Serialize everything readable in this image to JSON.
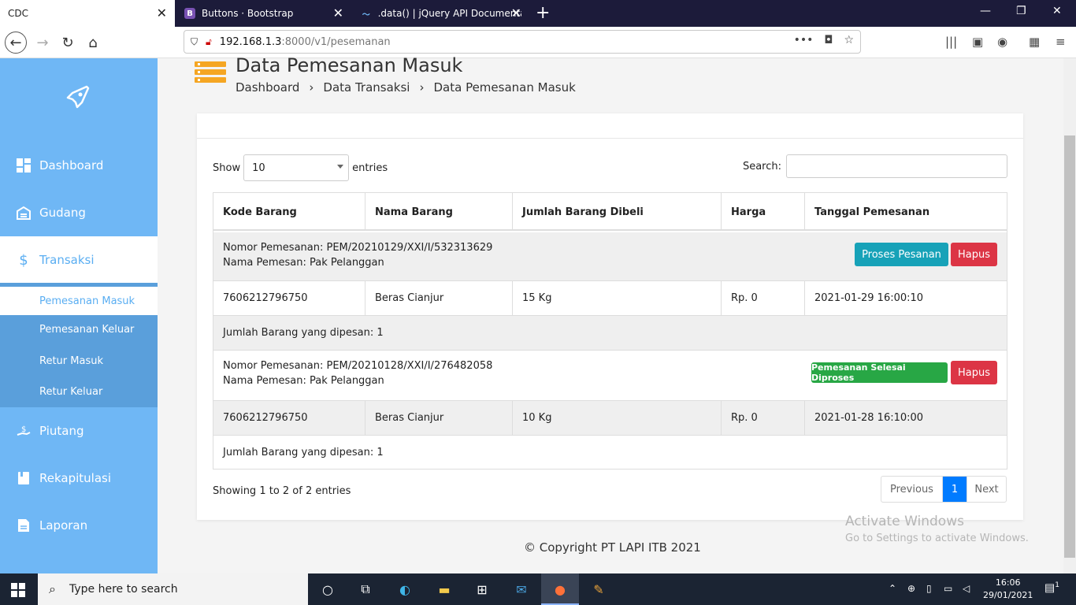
{
  "browser": {
    "tabs": [
      {
        "label": "CDC",
        "active": true
      },
      {
        "label": "Buttons · Bootstrap",
        "favicon": "B"
      },
      {
        "label": ".data() | jQuery API Documenta",
        "favicon": "jq"
      }
    ],
    "url_host": "192.168.1.3",
    "url_path": ":8000/v1/pesemanan",
    "url_path_display": ":8000/v1/pesemanan"
  },
  "sidebar": {
    "items": [
      {
        "label": "Dashboard",
        "icon": "dashboard-icon"
      },
      {
        "label": "Gudang",
        "icon": "warehouse-icon"
      },
      {
        "label": "Transaksi",
        "icon": "dollar-icon"
      },
      {
        "label": "Piutang",
        "icon": "hand-dollar-icon"
      },
      {
        "label": "Rekapitulasi",
        "icon": "book-icon"
      },
      {
        "label": "Laporan",
        "icon": "document-icon"
      }
    ],
    "sub_items": [
      {
        "label": "Pemesanan Masuk"
      },
      {
        "label": "Pemesanan Keluar"
      },
      {
        "label": "Retur Masuk"
      },
      {
        "label": "Retur Keluar"
      }
    ]
  },
  "page": {
    "title": "Data Pemesanan Masuk",
    "breadcrumb": [
      "Dashboard",
      "›",
      "Data Transaksi",
      "›",
      "Data Pemesanan Masuk"
    ]
  },
  "table": {
    "show_label": "Show",
    "entries_label": "entries",
    "page_size": "10",
    "search_label": "Search:",
    "columns": [
      "Kode Barang",
      "Nama Barang",
      "Jumlah Barang Dibeli",
      "Harga",
      "Tanggal Pemesanan"
    ],
    "orders": [
      {
        "nomor": "Nomor Pemesanan: PEM/20210129/XXI/I/532313629",
        "nama": "Nama Pemesan: Pak Pelanggan",
        "action_primary": "Proses Pesanan",
        "action_delete": "Hapus",
        "row": [
          "7606212796750",
          "Beras Cianjur",
          "15 Kg",
          "Rp. 0",
          "2021-01-29 16:00:10"
        ],
        "summary": "Jumlah Barang yang dipesan: 1"
      },
      {
        "nomor": "Nomor Pemesanan: PEM/20210128/XXI/I/276482058",
        "nama": "Nama Pemesan: Pak Pelanggan",
        "action_primary": "Pemesanan Selesai Diproses",
        "action_delete": "Hapus",
        "row": [
          "7606212796750",
          "Beras Cianjur",
          "10 Kg",
          "Rp. 0",
          "2021-01-28 16:10:00"
        ],
        "summary": "Jumlah Barang yang dipesan: 1"
      }
    ],
    "info": "Showing 1 to 2 of 2 entries",
    "pager": {
      "prev": "Previous",
      "current": "1",
      "next": "Next"
    }
  },
  "footer": {
    "copyright": "© Copyright PT LAPI ITB 2021"
  },
  "watermark": {
    "line1": "Activate Windows",
    "line2": "Go to Settings to activate Windows."
  },
  "taskbar": {
    "search_placeholder": "Type here to search",
    "time": "16:06",
    "date": "29/01/2021",
    "notifications": "1"
  },
  "colors": {
    "sidebar": "#6fb7f5",
    "accent_info": "#17a2b8",
    "danger": "#dc3545",
    "success": "#28a745",
    "page_icon": "#f5a623",
    "pager_active": "#007bff"
  }
}
